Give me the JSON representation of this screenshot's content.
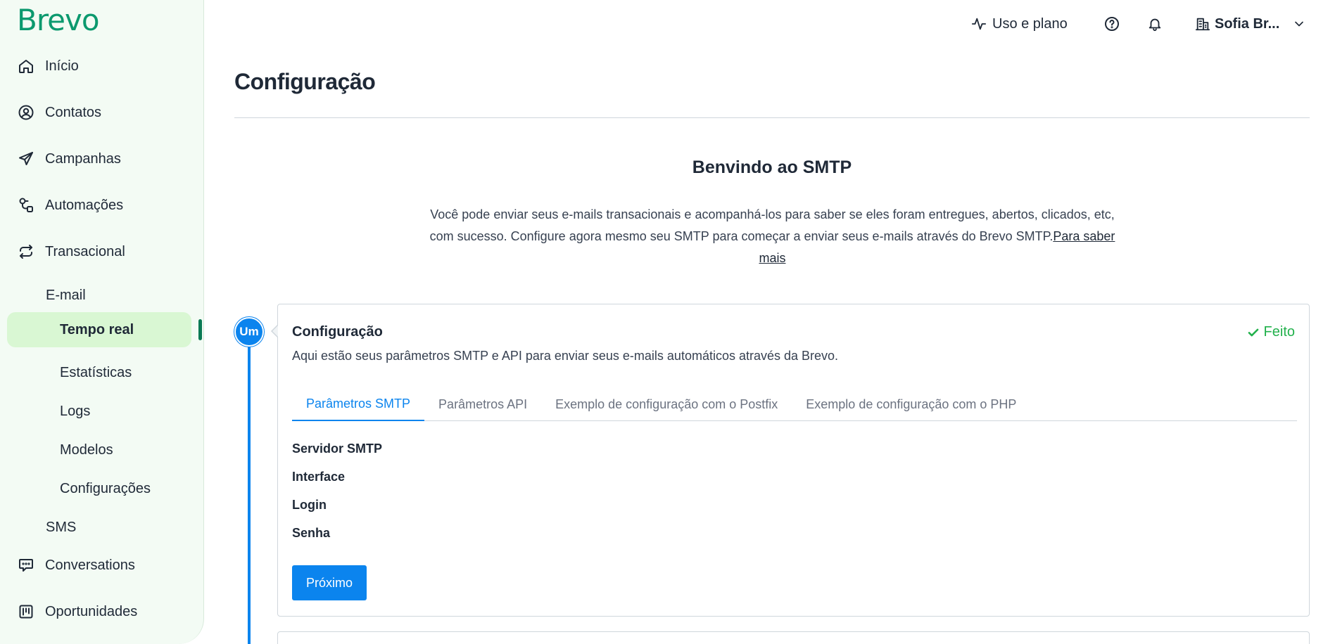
{
  "brand": {
    "name": "Brevo"
  },
  "sidebar": {
    "items": [
      {
        "label": "Início",
        "icon": "home-icon"
      },
      {
        "label": "Contatos",
        "icon": "contacts-icon"
      },
      {
        "label": "Campanhas",
        "icon": "send-icon"
      },
      {
        "label": "Automações",
        "icon": "automation-icon"
      },
      {
        "label": "Transacional",
        "icon": "transactional-icon"
      }
    ],
    "transactional": {
      "email_label": "E-mail",
      "sub_items": [
        {
          "label": "Tempo real",
          "active": true
        },
        {
          "label": "Estatísticas"
        },
        {
          "label": "Logs"
        },
        {
          "label": "Modelos"
        },
        {
          "label": "Configurações"
        }
      ],
      "sms_label": "SMS"
    },
    "bottom_items": [
      {
        "label": "Conversations",
        "icon": "chat-icon"
      },
      {
        "label": "Oportunidades",
        "icon": "kanban-icon"
      }
    ]
  },
  "header": {
    "usage_label": "Uso e plano",
    "user_name": "Sofia Br..."
  },
  "page": {
    "title": "Configuração",
    "welcome_title": "Benvindo ao SMTP",
    "welcome_text": "Você pode enviar seus e-mails transacionais e acompanhá-los para saber se eles foram entregues, abertos, clicados, etc, com sucesso. Configure agora mesmo seu SMTP para começar a enviar seus e-mails através do Brevo SMTP.",
    "learn_more": "Para saber mais"
  },
  "step": {
    "badge": "Um",
    "title": "Configuração",
    "status": "Feito",
    "description": "Aqui estão seus parâmetros SMTP e API para enviar seus e-mails automáticos através da Brevo.",
    "tabs": [
      {
        "label": "Parâmetros SMTP",
        "active": true
      },
      {
        "label": "Parâmetros API"
      },
      {
        "label": "Exemplo de configuração com o Postfix"
      },
      {
        "label": "Exemplo de configuração com o PHP"
      }
    ],
    "fields": [
      "Servidor SMTP",
      "Interface",
      "Login",
      "Senha"
    ],
    "next_label": "Próximo"
  },
  "colors": {
    "brand_green": "#0b996e",
    "active_bg": "#d9f7d3",
    "primary_blue": "#0b84ee",
    "success_green": "#22b14c"
  }
}
